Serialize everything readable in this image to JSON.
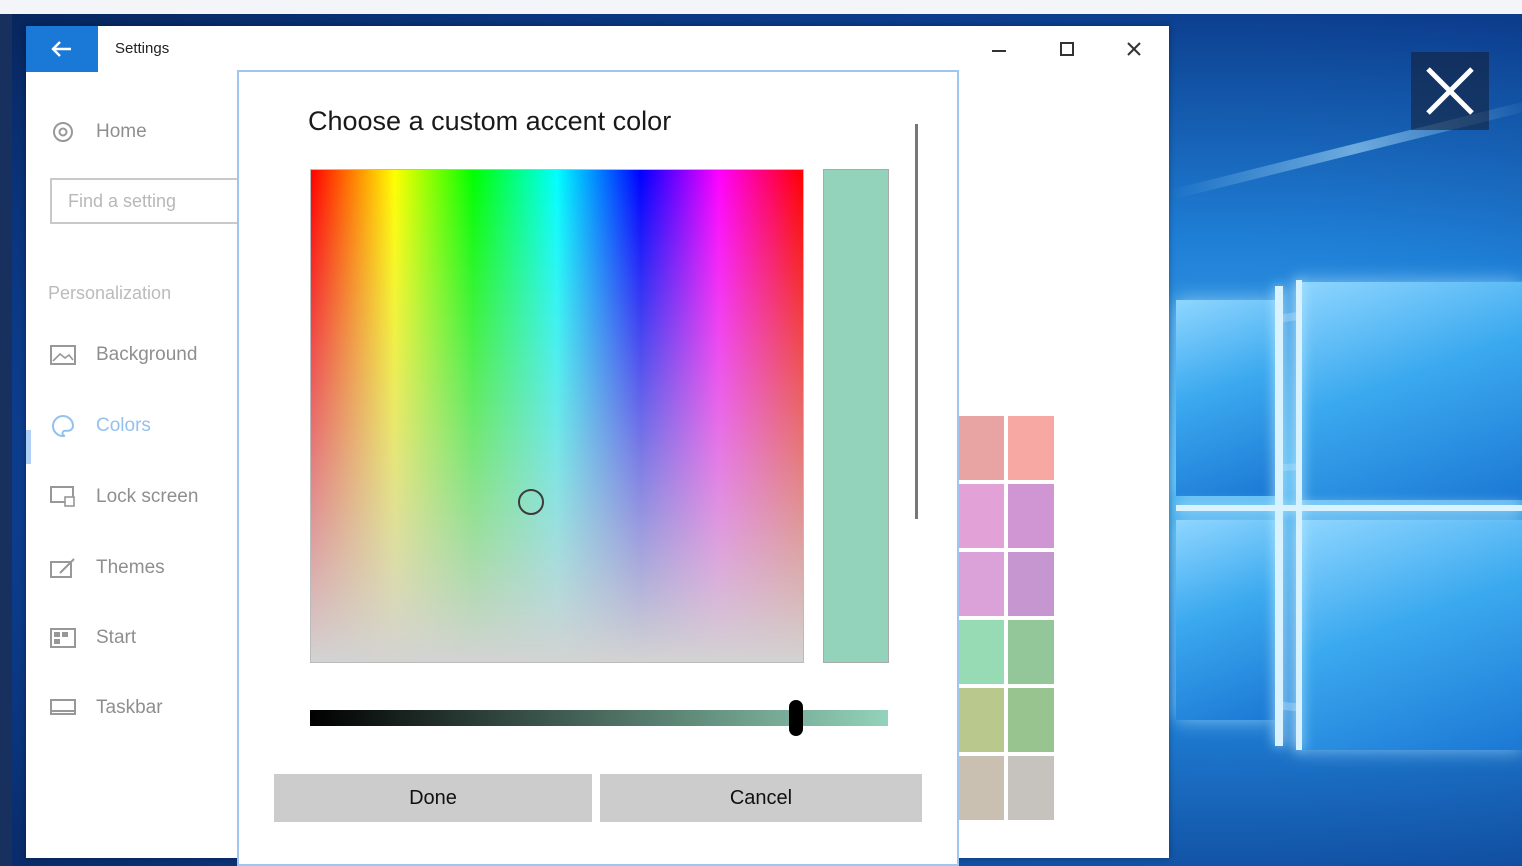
{
  "settings_window": {
    "title": "Settings",
    "controls": {
      "minimize_icon": "minimize-icon",
      "maximize_icon": "maximize-icon",
      "close_icon": "close-icon"
    }
  },
  "sidebar": {
    "home_label": "Home",
    "search_placeholder": "Find a setting",
    "section_heading": "Personalization",
    "items": [
      {
        "label": "Background",
        "icon": "picture-icon"
      },
      {
        "label": "Colors",
        "icon": "palette-icon",
        "selected": true
      },
      {
        "label": "Lock screen",
        "icon": "lock-screen-icon"
      },
      {
        "label": "Themes",
        "icon": "brush-icon"
      },
      {
        "label": "Start",
        "icon": "start-icon"
      },
      {
        "label": "Taskbar",
        "icon": "taskbar-icon"
      }
    ]
  },
  "accent_swatches": [
    [
      "#e8a3a3",
      "#f7a8a2"
    ],
    [
      "#e2a2d8",
      "#d096d3"
    ],
    [
      "#dba2d9",
      "#c596cf"
    ],
    [
      "#96dbb4",
      "#93c799"
    ],
    [
      "#b9c98e",
      "#98c48f"
    ],
    [
      "#cac0b2",
      "#c6c2be"
    ]
  ],
  "dialog": {
    "title": "Choose a custom accent color",
    "selected_color": "#93d3bb",
    "brightness_fraction": 0.84,
    "done_label": "Done",
    "cancel_label": "Cancel"
  },
  "overlay": {
    "close_icon": "close-icon"
  }
}
